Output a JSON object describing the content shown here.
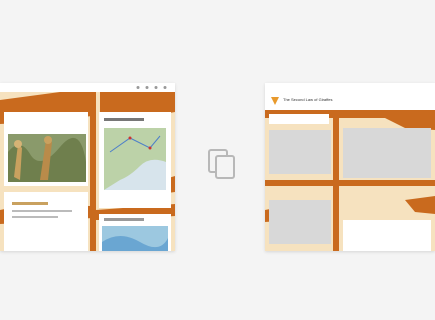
{
  "left_preview": {
    "header_text": "",
    "card_left_title": "",
    "card_left_caption": "",
    "card_map_title": "",
    "card_map_caption": ""
  },
  "right_preview": {
    "logo_icon": "cone-logo-icon",
    "title": "The Second Law of Giraffes",
    "subtitle": ""
  },
  "center_icon": "copy-icon",
  "colors": {
    "background": "#f4f4f4",
    "orange": "#c96a1e",
    "cream": "#f6e2bf",
    "placeholder_gray": "#d8d8d8",
    "fab_pink": "#e8366b"
  }
}
